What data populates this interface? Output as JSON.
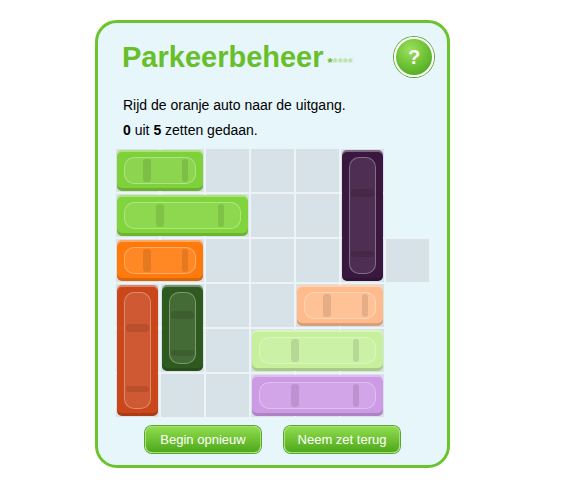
{
  "title": "Parkeerbeheer",
  "stars": [
    {
      "symbol": "*",
      "filled": true
    },
    {
      "symbol": "*",
      "filled": false
    },
    {
      "symbol": "*",
      "filled": false
    },
    {
      "symbol": "*",
      "filled": false
    },
    {
      "symbol": "*",
      "filled": false
    }
  ],
  "help_button": "?",
  "instruction": "Rijd de oranje auto naar de uitgang.",
  "moves": {
    "done": "0",
    "separator": "uit",
    "total": "5",
    "suffix": "zetten gedaan."
  },
  "board": {
    "rows": 6,
    "cols": 6,
    "exit_row": 2
  },
  "cars": [
    {
      "name": "green-car",
      "row": 0,
      "col": 0,
      "length": 2,
      "orientation": "horizontal",
      "color": "#7fd13b",
      "target": false
    },
    {
      "name": "green-truck",
      "row": 1,
      "col": 0,
      "length": 3,
      "orientation": "horizontal",
      "color": "#80d43c",
      "target": false
    },
    {
      "name": "orange-car",
      "row": 2,
      "col": 0,
      "length": 2,
      "orientation": "horizontal",
      "color": "#ff7a0c",
      "target": true
    },
    {
      "name": "purple-truck",
      "row": 0,
      "col": 5,
      "length": 3,
      "orientation": "vertical",
      "color": "#3a173f",
      "target": false
    },
    {
      "name": "red-truck",
      "row": 3,
      "col": 0,
      "length": 3,
      "orientation": "vertical",
      "color": "#c9471b",
      "target": false
    },
    {
      "name": "dark-green-car",
      "row": 3,
      "col": 1,
      "length": 2,
      "orientation": "vertical",
      "color": "#2f5a1f",
      "target": false
    },
    {
      "name": "peach-car",
      "row": 3,
      "col": 4,
      "length": 2,
      "orientation": "horizontal",
      "color": "#ffbb8c",
      "target": false
    },
    {
      "name": "pale-green-truck",
      "row": 4,
      "col": 3,
      "length": 3,
      "orientation": "horizontal",
      "color": "#c6f09c",
      "target": false
    },
    {
      "name": "lilac-truck",
      "row": 5,
      "col": 3,
      "length": 3,
      "orientation": "horizontal",
      "color": "#cd9ae6",
      "target": false
    }
  ],
  "buttons": [
    "Begin opnieuw",
    "Neem zet terug"
  ]
}
